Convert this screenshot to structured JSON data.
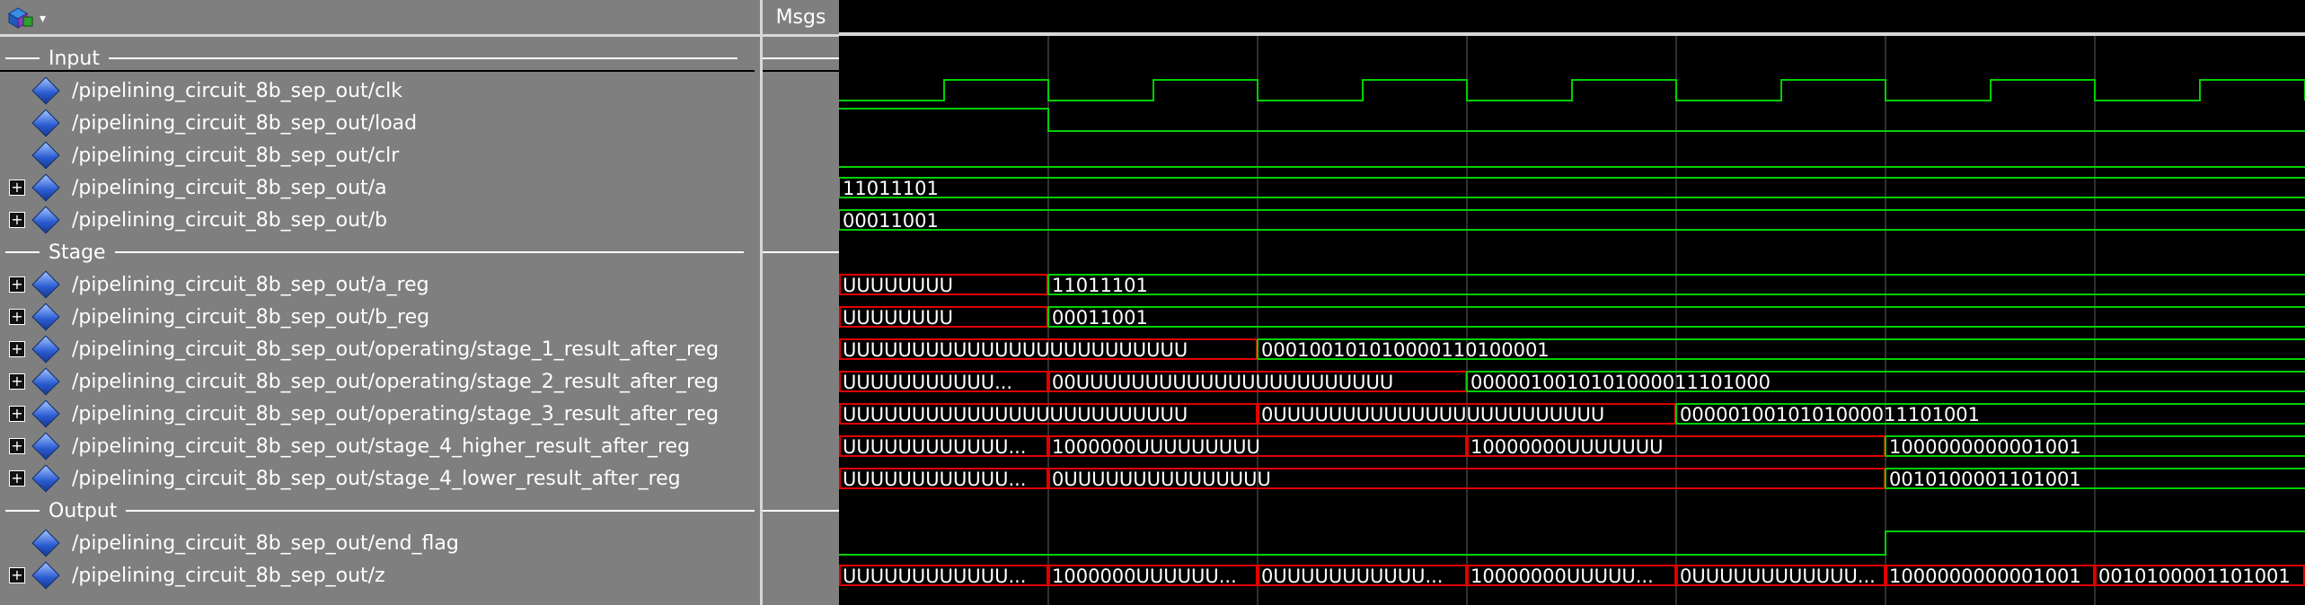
{
  "toolbar": {
    "icon": "wave-objects-icon",
    "arrow": "▾"
  },
  "header": {
    "msgs": "Msgs"
  },
  "groups": [
    {
      "label": "Input"
    },
    {
      "label": "Stage"
    },
    {
      "label": "Output"
    }
  ],
  "signals": [
    {
      "name": "/pipelining_circuit_8b_sep_out/clk",
      "expandable": false
    },
    {
      "name": "/pipelining_circuit_8b_sep_out/load",
      "expandable": false
    },
    {
      "name": "/pipelining_circuit_8b_sep_out/clr",
      "expandable": false
    },
    {
      "name": "/pipelining_circuit_8b_sep_out/a",
      "expandable": true
    },
    {
      "name": "/pipelining_circuit_8b_sep_out/b",
      "expandable": true
    },
    {
      "name": "/pipelining_circuit_8b_sep_out/a_reg",
      "expandable": true
    },
    {
      "name": "/pipelining_circuit_8b_sep_out/b_reg",
      "expandable": true
    },
    {
      "name": "/pipelining_circuit_8b_sep_out/operating/stage_1_result_after_reg",
      "expandable": true
    },
    {
      "name": "/pipelining_circuit_8b_sep_out/operating/stage_2_result_after_reg",
      "expandable": true
    },
    {
      "name": "/pipelining_circuit_8b_sep_out/operating/stage_3_result_after_reg",
      "expandable": true
    },
    {
      "name": "/pipelining_circuit_8b_sep_out/stage_4_higher_result_after_reg",
      "expandable": true
    },
    {
      "name": "/pipelining_circuit_8b_sep_out/stage_4_lower_result_after_reg",
      "expandable": true
    },
    {
      "name": "/pipelining_circuit_8b_sep_out/end_flag",
      "expandable": false
    },
    {
      "name": "/pipelining_circuit_8b_sep_out/z",
      "expandable": true
    }
  ],
  "colors": {
    "wave": "#00d000",
    "unknown": "#e00000",
    "text": "#ffffff",
    "grid": "#606060"
  },
  "waves": {
    "a_value": "11011101",
    "b_value": "00011001",
    "a_reg": [
      "UUUUUUUU",
      "11011101"
    ],
    "b_reg": [
      "UUUUUUUU",
      "00011001"
    ],
    "stage1": [
      "UUUUUUUUUUUUUUUUUUUUUUUUU",
      "000100101010000110100001"
    ],
    "stage2": [
      "UUUUUUUUUUU...",
      "00UUUUUUUUUUUUUUUUUUUUUUU",
      "0000010010101000011101000"
    ],
    "stage3": [
      "UUUUUUUUUUUUUUUUUUUUUUUUU",
      "0UUUUUUUUUUUUUUUUUUUUUUUU",
      "0000010010101000011101001"
    ],
    "higher": [
      "UUUUUUUUUUUU...",
      "1000000UUUUUUUUU",
      "10000000UUUUUUU",
      "1000000000001001"
    ],
    "lower": [
      "UUUUUUUUUUUU...",
      "0UUUUUUUUUUUUUUU",
      "0010100001101001"
    ],
    "z": [
      "UUUUUUUUUUUU...",
      "1000000UUUUUU...",
      "0UUUUUUUUUUU...",
      "10000000UUUUU...",
      "0UUUUUUUUUUUU...",
      "1000000000001001",
      "0010100001101001"
    ]
  }
}
